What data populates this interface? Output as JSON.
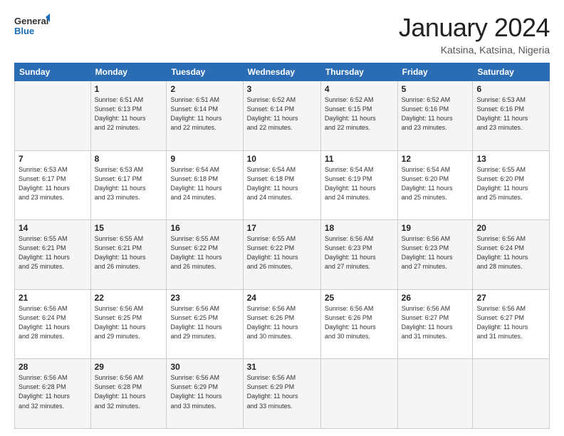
{
  "logo": {
    "line1": "General",
    "line2": "Blue"
  },
  "header": {
    "month": "January 2024",
    "location": "Katsina, Katsina, Nigeria"
  },
  "days_of_week": [
    "Sunday",
    "Monday",
    "Tuesday",
    "Wednesday",
    "Thursday",
    "Friday",
    "Saturday"
  ],
  "weeks": [
    [
      {
        "day": "",
        "info": ""
      },
      {
        "day": "1",
        "info": "Sunrise: 6:51 AM\nSunset: 6:13 PM\nDaylight: 11 hours\nand 22 minutes."
      },
      {
        "day": "2",
        "info": "Sunrise: 6:51 AM\nSunset: 6:14 PM\nDaylight: 11 hours\nand 22 minutes."
      },
      {
        "day": "3",
        "info": "Sunrise: 6:52 AM\nSunset: 6:14 PM\nDaylight: 11 hours\nand 22 minutes."
      },
      {
        "day": "4",
        "info": "Sunrise: 6:52 AM\nSunset: 6:15 PM\nDaylight: 11 hours\nand 22 minutes."
      },
      {
        "day": "5",
        "info": "Sunrise: 6:52 AM\nSunset: 6:16 PM\nDaylight: 11 hours\nand 23 minutes."
      },
      {
        "day": "6",
        "info": "Sunrise: 6:53 AM\nSunset: 6:16 PM\nDaylight: 11 hours\nand 23 minutes."
      }
    ],
    [
      {
        "day": "7",
        "info": "Sunrise: 6:53 AM\nSunset: 6:17 PM\nDaylight: 11 hours\nand 23 minutes."
      },
      {
        "day": "8",
        "info": "Sunrise: 6:53 AM\nSunset: 6:17 PM\nDaylight: 11 hours\nand 23 minutes."
      },
      {
        "day": "9",
        "info": "Sunrise: 6:54 AM\nSunset: 6:18 PM\nDaylight: 11 hours\nand 24 minutes."
      },
      {
        "day": "10",
        "info": "Sunrise: 6:54 AM\nSunset: 6:18 PM\nDaylight: 11 hours\nand 24 minutes."
      },
      {
        "day": "11",
        "info": "Sunrise: 6:54 AM\nSunset: 6:19 PM\nDaylight: 11 hours\nand 24 minutes."
      },
      {
        "day": "12",
        "info": "Sunrise: 6:54 AM\nSunset: 6:20 PM\nDaylight: 11 hours\nand 25 minutes."
      },
      {
        "day": "13",
        "info": "Sunrise: 6:55 AM\nSunset: 6:20 PM\nDaylight: 11 hours\nand 25 minutes."
      }
    ],
    [
      {
        "day": "14",
        "info": "Sunrise: 6:55 AM\nSunset: 6:21 PM\nDaylight: 11 hours\nand 25 minutes."
      },
      {
        "day": "15",
        "info": "Sunrise: 6:55 AM\nSunset: 6:21 PM\nDaylight: 11 hours\nand 26 minutes."
      },
      {
        "day": "16",
        "info": "Sunrise: 6:55 AM\nSunset: 6:22 PM\nDaylight: 11 hours\nand 26 minutes."
      },
      {
        "day": "17",
        "info": "Sunrise: 6:55 AM\nSunset: 6:22 PM\nDaylight: 11 hours\nand 26 minutes."
      },
      {
        "day": "18",
        "info": "Sunrise: 6:56 AM\nSunset: 6:23 PM\nDaylight: 11 hours\nand 27 minutes."
      },
      {
        "day": "19",
        "info": "Sunrise: 6:56 AM\nSunset: 6:23 PM\nDaylight: 11 hours\nand 27 minutes."
      },
      {
        "day": "20",
        "info": "Sunrise: 6:56 AM\nSunset: 6:24 PM\nDaylight: 11 hours\nand 28 minutes."
      }
    ],
    [
      {
        "day": "21",
        "info": "Sunrise: 6:56 AM\nSunset: 6:24 PM\nDaylight: 11 hours\nand 28 minutes."
      },
      {
        "day": "22",
        "info": "Sunrise: 6:56 AM\nSunset: 6:25 PM\nDaylight: 11 hours\nand 29 minutes."
      },
      {
        "day": "23",
        "info": "Sunrise: 6:56 AM\nSunset: 6:25 PM\nDaylight: 11 hours\nand 29 minutes."
      },
      {
        "day": "24",
        "info": "Sunrise: 6:56 AM\nSunset: 6:26 PM\nDaylight: 11 hours\nand 30 minutes."
      },
      {
        "day": "25",
        "info": "Sunrise: 6:56 AM\nSunset: 6:26 PM\nDaylight: 11 hours\nand 30 minutes."
      },
      {
        "day": "26",
        "info": "Sunrise: 6:56 AM\nSunset: 6:27 PM\nDaylight: 11 hours\nand 31 minutes."
      },
      {
        "day": "27",
        "info": "Sunrise: 6:56 AM\nSunset: 6:27 PM\nDaylight: 11 hours\nand 31 minutes."
      }
    ],
    [
      {
        "day": "28",
        "info": "Sunrise: 6:56 AM\nSunset: 6:28 PM\nDaylight: 11 hours\nand 32 minutes."
      },
      {
        "day": "29",
        "info": "Sunrise: 6:56 AM\nSunset: 6:28 PM\nDaylight: 11 hours\nand 32 minutes."
      },
      {
        "day": "30",
        "info": "Sunrise: 6:56 AM\nSunset: 6:29 PM\nDaylight: 11 hours\nand 33 minutes."
      },
      {
        "day": "31",
        "info": "Sunrise: 6:56 AM\nSunset: 6:29 PM\nDaylight: 11 hours\nand 33 minutes."
      },
      {
        "day": "",
        "info": ""
      },
      {
        "day": "",
        "info": ""
      },
      {
        "day": "",
        "info": ""
      }
    ]
  ]
}
